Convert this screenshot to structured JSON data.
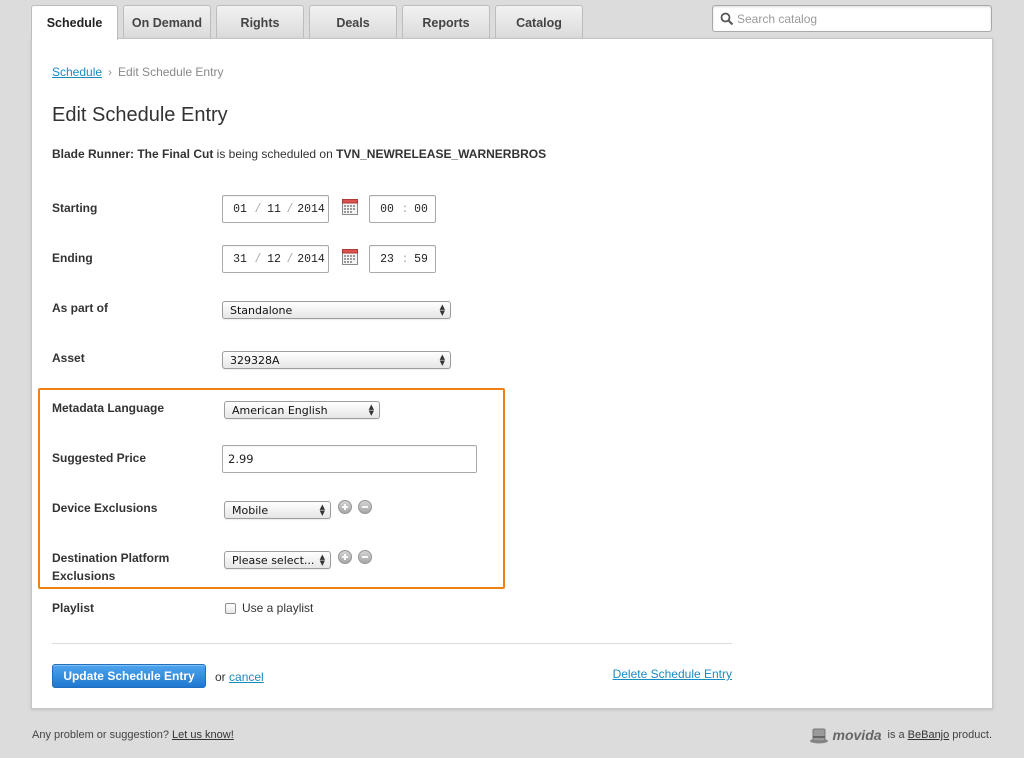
{
  "tabs": [
    {
      "label": "Schedule",
      "active": true
    },
    {
      "label": "On Demand"
    },
    {
      "label": "Rights"
    },
    {
      "label": "Deals"
    },
    {
      "label": "Reports"
    },
    {
      "label": "Catalog"
    }
  ],
  "search": {
    "placeholder": "Search catalog",
    "icon": "search-icon"
  },
  "breadcrumb": {
    "link": "Schedule",
    "separator": "›",
    "current": "Edit Schedule Entry"
  },
  "page_title": "Edit Schedule Entry",
  "subtitle": {
    "title": "Blade Runner: The Final Cut",
    "middle": " is being scheduled on ",
    "platform": "TVN_NEWRELEASE_WARNERBROS"
  },
  "form": {
    "starting": {
      "label": "Starting",
      "day": "01",
      "month": "11",
      "year": "2014",
      "hour": "00",
      "minute": "00"
    },
    "ending": {
      "label": "Ending",
      "day": "31",
      "month": "12",
      "year": "2014",
      "hour": "23",
      "minute": "59"
    },
    "as_part_of": {
      "label": "As part of",
      "value": "Standalone"
    },
    "asset": {
      "label": "Asset",
      "value": "329328A"
    },
    "metadata_language": {
      "label": "Metadata Language",
      "value": "American English"
    },
    "suggested_price": {
      "label": "Suggested Price",
      "value": "2.99"
    },
    "device_exclusions": {
      "label": "Device Exclusions",
      "value": "Mobile"
    },
    "destination_platform_exclusions": {
      "label_line1": "Destination Platform",
      "label_line2": "Exclusions",
      "value": "Please select..."
    },
    "playlist": {
      "label": "Playlist",
      "checkbox_label": "Use a playlist",
      "checked": false
    }
  },
  "actions": {
    "update": "Update Schedule Entry",
    "or": "or",
    "cancel": "cancel",
    "delete": "Delete Schedule Entry"
  },
  "footer": {
    "left_text": "Any problem or suggestion?",
    "left_link": "Let us know!",
    "brand": "movida",
    "is_a": "is a",
    "company": "BeBanjo",
    "product": "product."
  },
  "colors": {
    "highlight": "#f07f14",
    "primary_button": "#1e78cf",
    "link": "#1a8bc0"
  }
}
